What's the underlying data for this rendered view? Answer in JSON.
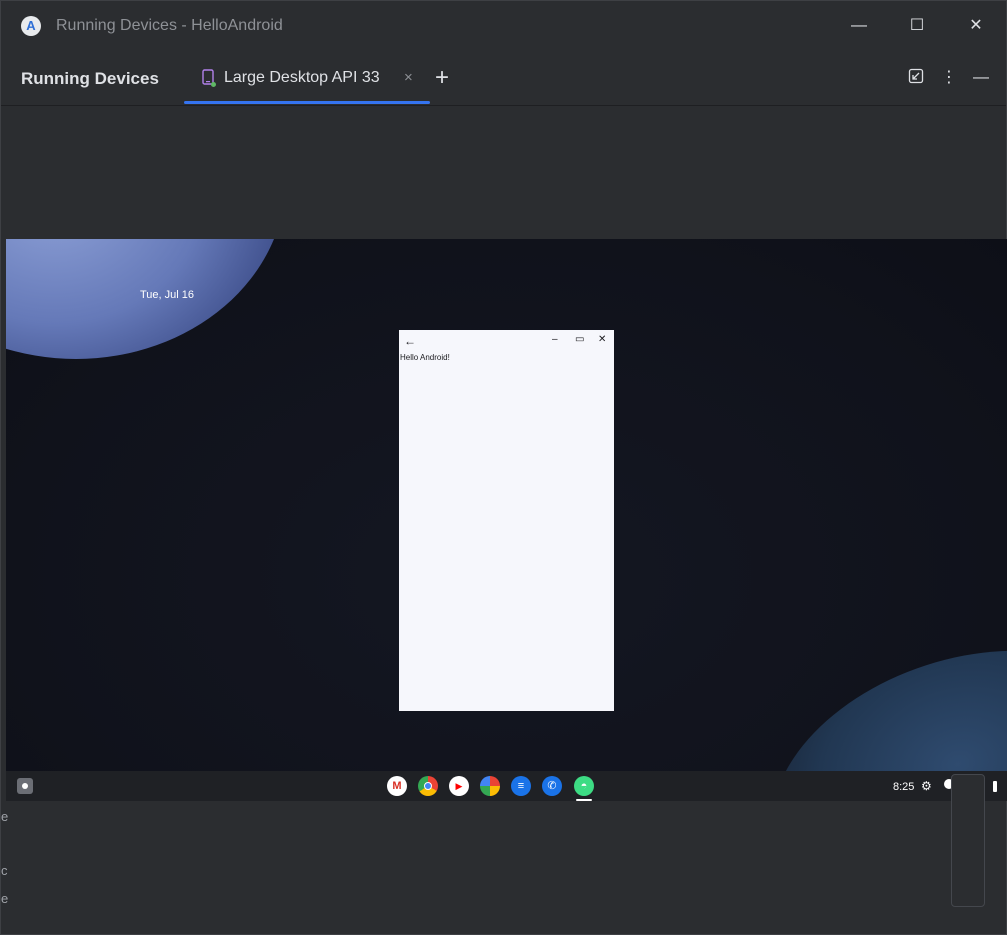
{
  "window": {
    "title": "Running Devices - HelloAndroid",
    "logo_glyph": "A",
    "minimize_glyph": "—",
    "maximize_glyph": "☐",
    "close_glyph": "✕"
  },
  "tool_window": {
    "title": "Running Devices",
    "tab_label": "Large Desktop API 33",
    "tab_close_glyph": "×",
    "add_tab_glyph": "+",
    "more_glyph": "⋮",
    "hide_glyph": "—",
    "accent_color": "#3574f0"
  },
  "device": {
    "date": "Tue, Jul 16",
    "app_window": {
      "back_glyph": "←",
      "minimize_glyph": "–",
      "maximize_glyph": "▭",
      "close_glyph": "✕",
      "content_text": "Hello Android!"
    },
    "shelf": {
      "apps": [
        "gmail",
        "chrome",
        "youtube",
        "photos",
        "messages",
        "phone",
        "android-app"
      ],
      "gmail_glyph": "M",
      "youtube_glyph": "▶",
      "messages_glyph": "≡",
      "phone_glyph": "✆",
      "android_glyph": "◓",
      "time": "8:25",
      "settings_glyph": "⚙"
    }
  },
  "side_letters": [
    "e",
    "c",
    "e"
  ]
}
